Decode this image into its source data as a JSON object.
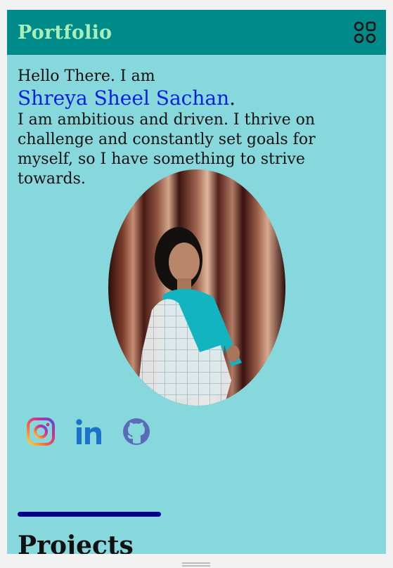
{
  "header": {
    "brand": "Portfolio",
    "menu_icon": "grid-icon"
  },
  "intro": {
    "greeting": "Hello There. I am",
    "name": "Shreya Sheel Sachan",
    "name_suffix": ".",
    "bio": "I am ambitious and driven. I thrive on challenge and constantly set goals for myself, so I have something to strive towards."
  },
  "profile_photo": {
    "alt": "profile photo"
  },
  "socials": [
    {
      "name": "instagram",
      "icon": "instagram-icon"
    },
    {
      "name": "linkedin",
      "icon": "linkedin-icon"
    },
    {
      "name": "github",
      "icon": "github-icon"
    }
  ],
  "projects": {
    "title": "Projects"
  },
  "colors": {
    "navbar": "#008b8a",
    "brand": "#a8eeb9",
    "background": "#86d8dc",
    "name": "#0a1fe0",
    "divider": "#00008b"
  }
}
